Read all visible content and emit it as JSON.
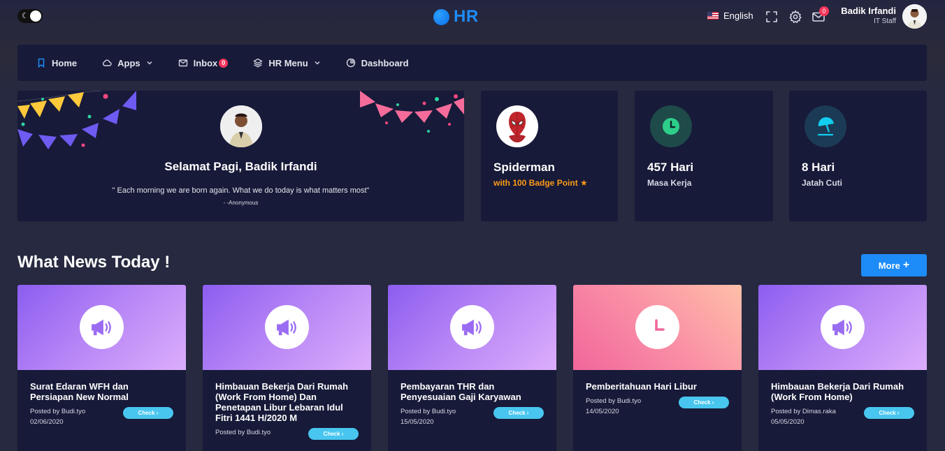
{
  "topbar": {
    "logo_text": "HR",
    "language": "English",
    "mail_count": "0",
    "user_name": "Badik Irfandi",
    "user_role": "IT Staff"
  },
  "nav": {
    "items": [
      {
        "label": "Home",
        "icon": "bookmark-icon"
      },
      {
        "label": "Apps",
        "icon": "cloud-icon"
      },
      {
        "label": "Inbox",
        "icon": "mail-icon",
        "badge": "0"
      },
      {
        "label": "HR Menu",
        "icon": "layers-icon"
      },
      {
        "label": "Dashboard",
        "icon": "pie-chart-icon"
      }
    ]
  },
  "welcome": {
    "greeting": "Selamat Pagi, Badik Irfandi",
    "quote": "\" Each morning we are born again. What we do today is what matters most\"",
    "author": "- -Anonymous"
  },
  "stats": [
    {
      "title": "Spiderman",
      "subtitle": "with 100 Badge Point ★",
      "icon": "spiderman-avatar"
    },
    {
      "title": "457 Hari",
      "subtitle": "Masa Kerja",
      "icon": "clock-icon",
      "color": "#2dce89"
    },
    {
      "title": "8 Hari",
      "subtitle": "Jatah Cuti",
      "icon": "beach-umbrella-icon",
      "color": "#11cdef"
    }
  ],
  "news": {
    "title": "What News Today !",
    "more_label": "More",
    "check_label": "Check",
    "items": [
      {
        "headline": "Surat Edaran WFH dan Persiapan New Normal",
        "posted_by": "Posted by Budi.tyo",
        "date": "02/06/2020",
        "icon": "megaphone-icon"
      },
      {
        "headline": "Himbauan Bekerja Dari Rumah (Work From Home) Dan Penetapan Libur Lebaran Idul Fitri 1441 H/2020 M",
        "posted_by": "Posted by Budi.tyo",
        "date": "",
        "icon": "megaphone-icon"
      },
      {
        "headline": "Pembayaran THR dan Penyesuaian Gaji Karyawan",
        "posted_by": "Posted by Budi.tyo",
        "date": "15/05/2020",
        "icon": "megaphone-icon"
      },
      {
        "headline": "Pemberitahuan Hari Libur",
        "posted_by": "Posted by Budi.tyo",
        "date": "14/05/2020",
        "icon": "clock-icon"
      },
      {
        "headline": "Himbauan Bekerja Dari Rumah (Work From Home)",
        "posted_by": "Posted by Dimas.raka",
        "date": "05/05/2020",
        "icon": "megaphone-icon"
      }
    ]
  },
  "colors": {
    "accent": "#1d8cf8",
    "danger": "#f5365c",
    "card_bg": "#171a38",
    "page_bg": "#26293f",
    "orange": "#fb9b19",
    "check_button": "#48c6ef"
  }
}
